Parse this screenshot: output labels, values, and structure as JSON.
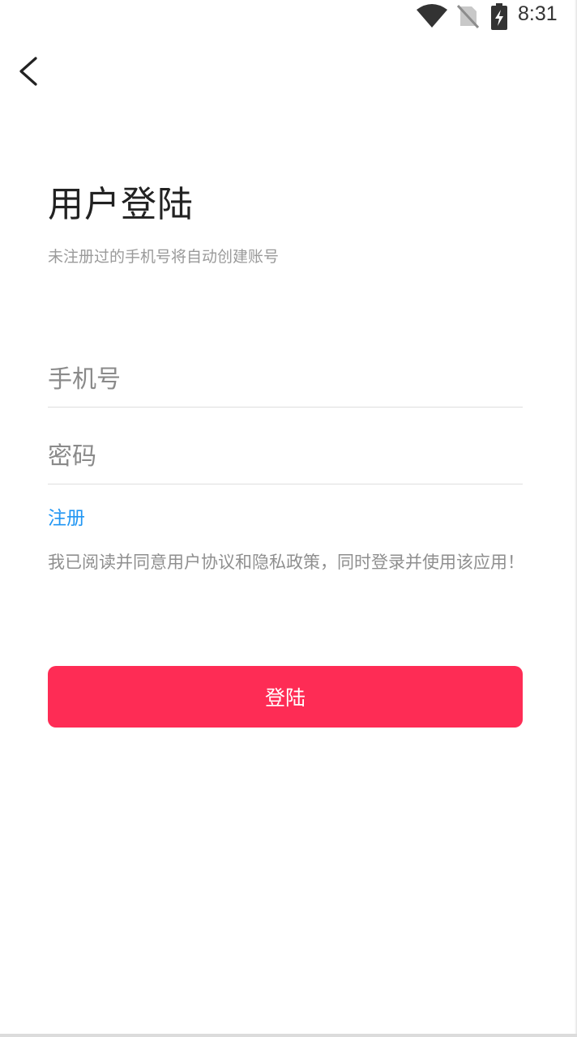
{
  "status_bar": {
    "time": "8:31",
    "icons": [
      "wifi-icon",
      "no-sim-icon",
      "battery-charging-icon"
    ]
  },
  "nav": {
    "back_icon": "chevron-left-icon"
  },
  "login": {
    "title": "用户登陆",
    "subtitle": "未注册过的手机号将自动创建账号",
    "phone_placeholder": "手机号",
    "password_placeholder": "密码",
    "register_label": "注册",
    "agreement_text": "我已阅读并同意用户协议和隐私政策，同时登录并使用该应用！",
    "submit_label": "登陆"
  },
  "colors": {
    "accent": "#fe2c55",
    "link": "#2196f3",
    "muted_text": "#8f8f8f"
  }
}
